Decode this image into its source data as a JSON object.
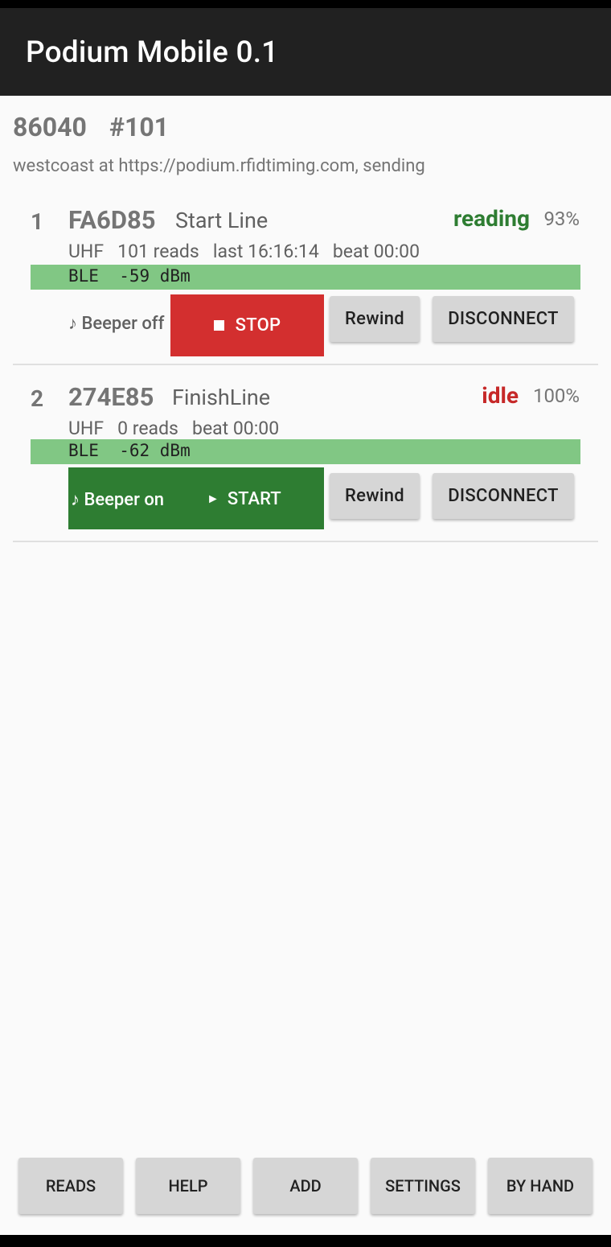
{
  "app": {
    "title": "Podium Mobile 0.1"
  },
  "event": {
    "id": "86040",
    "number": "#101",
    "server_status": "westcoast at https://podium.rfidtiming.com, sending"
  },
  "readers": [
    {
      "index": "1",
      "code": "FA6D85",
      "name": "Start Line",
      "state": "reading",
      "state_color": "#2e7d32",
      "battery": "93%",
      "uhf": "UHF   101 reads   last 16:16:14   beat 00:00",
      "ble": "BLE  -59 dBm",
      "beeper": "♪ Beeper off",
      "action": "STOP",
      "action_color": "#d32f2f",
      "action_icon": "stop-square-icon",
      "rewind": "Rewind",
      "disconnect": "DISCONNECT"
    },
    {
      "index": "2",
      "code": "274E85",
      "name": "FinishLine",
      "state": "idle",
      "state_color": "#c62828",
      "battery": "100%",
      "uhf": "UHF   0 reads   beat 00:00",
      "ble": "BLE  -62 dBm",
      "beeper": "♪ Beeper on",
      "action": "START",
      "action_color": "#2e7d32",
      "action_icon": "play-arrow-icon",
      "action_icon_glyph": "►",
      "rewind": "Rewind",
      "disconnect": "DISCONNECT"
    }
  ],
  "bottom_bar": {
    "reads": "READS",
    "help": "HELP",
    "add": "ADD",
    "settings": "SETTINGS",
    "by_hand": "BY HAND"
  },
  "colors": {
    "app_bar": "#212121",
    "ble_bar": "#81c784",
    "button_grey": "#d6d6d6"
  }
}
